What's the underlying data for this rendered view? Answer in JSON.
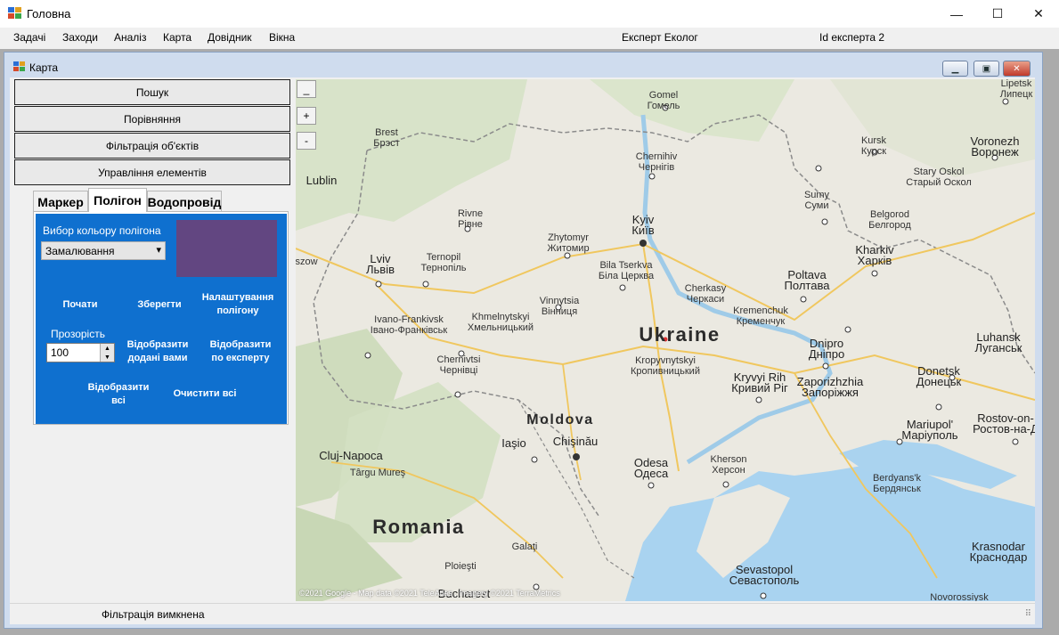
{
  "window": {
    "title": "Головна",
    "minimize": "—",
    "maximize": "☐",
    "close": "✕"
  },
  "menu": {
    "items": [
      "Задачі",
      "Заходи",
      "Аналіз",
      "Карта",
      "Довідник",
      "Вікна"
    ],
    "role": "Експерт Еколог",
    "expert_id": "Id експерта 2"
  },
  "child": {
    "title": "Карта"
  },
  "left_buttons": [
    "Пошук",
    "Порівняння",
    "Фільтрація об'єктів",
    "Управління елементів"
  ],
  "tabs": [
    {
      "label": "Маркер",
      "active": false
    },
    {
      "label": "Полігон",
      "active": true
    },
    {
      "label": "Водопровід",
      "active": false
    }
  ],
  "polygon_panel": {
    "color_label": "Вибор кольору полігона",
    "fill_mode": "Замалювання",
    "fill_color": "#624681",
    "start_button": "Почати",
    "save_button": "Зберегти",
    "settings_button": "Налаштування полігону",
    "opacity_label": "Прозорість",
    "opacity_value": "100",
    "show_added_button": "Відобразити додані вами",
    "show_by_expert_button": "Відобразити по експерту",
    "show_all_button": "Відобразити всі",
    "clear_all_button": "Очистити всі",
    "panel_color": "#0f70cf"
  },
  "map": {
    "zoom_out": "_",
    "zoom_in": "+",
    "zoom_minus": "-",
    "attribution": "©2021 Google - Map data ©2021 TeleAtlas , Imagery ©2021 TerraMetrics",
    "countries": {
      "ukraine": "Ukraine",
      "moldova": "Moldova",
      "romania": "Romania"
    },
    "cities": {
      "gomel": "Gomel\nГомель",
      "lipetsk": "Lipetsk\nЛипецк",
      "brest": "Brest\nБрэст",
      "chernihiv": "Chernihiv\nЧернігів",
      "kursk": "Kursk\nКурск",
      "voronezh": "Voronezh\nВоронеж",
      "stary_oskol": "Stary Oskol\nСтарый Оскол",
      "lublin": "Lublin",
      "rivne": "Rivne\nРівне",
      "kyiv": "Kyiv\nКиїв",
      "sumy": "Sumy\nСуми",
      "belgorod": "Belgorod\nБелгород",
      "zhytomyr": "Zhytomyr\nЖитомир",
      "szow": "szow",
      "lviv": "Lviv\nЛьвів",
      "ternopil": "Ternopil\nТернопіль",
      "bila_tserkva": "Bila Tserkva\nБіла Церква",
      "kharkiv": "Kharkiv\nХарків",
      "poltava": "Poltava\nПолтава",
      "cherkasy": "Cherkasy\nЧеркаси",
      "vinnytsia": "Vinnytsia\nВінниця",
      "kremenchuk": "Kremenchuk\nКременчук",
      "ivano": "Ivano-Frankivsk\nІвано-Франківськ",
      "khmelnytskyi": "Khmelnytskyi\nХмельницький",
      "luhansk": "Luhansk\nЛуганськ",
      "dnipro": "Dnipro\nДніпро",
      "kropyvnytskyi": "Kropyvnytskyi\nКропивницький",
      "chernivtsi": "Chernivtsi\nЧернівці",
      "donetsk": "Donetsk\nДонецьк",
      "kryvyi_rih": "Kryvyi Rih\nКривий Ріг",
      "zaporizhzhia": "Zaporizhzhia\nЗапоріжжя",
      "mariupol": "Mariupol'\nМаріуполь",
      "rostov": "Rostov-on-\nРостов-на-Д",
      "iasi": "Iaşio",
      "chisinau": "Chişinău",
      "cluj": "Cluj-Napoca",
      "targu_mures": "Târgu Mureş",
      "odesa": "Odesa\nОдеса",
      "kherson": "Kherson\nХерсон",
      "berdyansk": "Berdyans'k\nБердянськ",
      "galati": "Galaţi",
      "krasnodar": "Krasnodar\nКраснодар",
      "sevastopol": "Sevastopol\nСевастополь",
      "ploiesti": "Ploieşti",
      "bucharest": "Bucharest",
      "novorossiysk": "Novorossiysk"
    }
  },
  "status": {
    "text": "Фільтрація вимкнена"
  }
}
